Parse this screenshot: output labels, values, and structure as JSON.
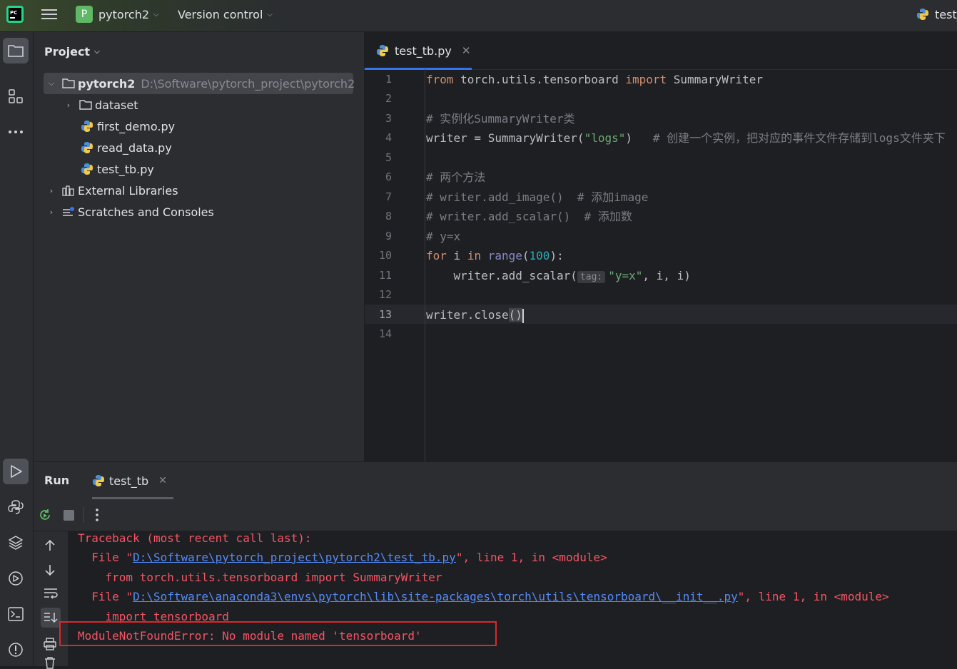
{
  "titlebar": {
    "project_badge": "P",
    "project_name": "pytorch2",
    "version_control": "Version control",
    "run_config": "test_"
  },
  "project_panel": {
    "title": "Project",
    "root_name": "pytorch2",
    "root_path": "D:\\Software\\pytorch_project\\pytorch2",
    "items": [
      {
        "label": "dataset",
        "kind": "folder"
      },
      {
        "label": "first_demo.py",
        "kind": "python"
      },
      {
        "label": "read_data.py",
        "kind": "python"
      },
      {
        "label": "test_tb.py",
        "kind": "python"
      }
    ],
    "external_libraries": "External Libraries",
    "scratches": "Scratches and Consoles"
  },
  "editor": {
    "tab_label": "test_tb.py",
    "line_numbers": [
      "1",
      "2",
      "3",
      "4",
      "5",
      "6",
      "7",
      "8",
      "9",
      "10",
      "11",
      "12",
      "13",
      "14"
    ],
    "current_line": "13",
    "code": {
      "l1_from": "from",
      "l1_mod": " torch.utils.tensorboard ",
      "l1_import": "import",
      "l1_name": " SummaryWriter",
      "l3": "# 实例化SummaryWriter类",
      "l4_code": "writer = SummaryWriter(",
      "l4_str": "\"logs\"",
      "l4_close": ")",
      "l4_comment": "   # 创建一个实例，把对应的事件文件存储到logs文件夹下",
      "l6": "# 两个方法",
      "l7": "# writer.add_image()  # 添加image",
      "l8": "# writer.add_scalar()  # 添加数",
      "l9": "# y=x",
      "l10_for": "for",
      "l10_i": " i ",
      "l10_in": "in",
      "l10_range": "range",
      "l10_open": "(",
      "l10_num": "100",
      "l10_close": "):",
      "l11_code": "    writer.add_scalar(",
      "l11_hint": "tag:",
      "l11_str": "\"y=x\"",
      "l11_rest": ", i, i)",
      "l13_code": "writer.close",
      "l13_paren": "()"
    }
  },
  "run_panel": {
    "title": "Run",
    "tab_label": "test_tb",
    "console": {
      "traceback": "Traceback (most recent call last):",
      "file1_prefix": "  File \"",
      "file1_path": "D:\\Software\\pytorch_project\\pytorch2\\test_tb.py",
      "file1_suffix": "\", line 1, in <module>",
      "code1": "    from torch.utils.tensorboard import SummaryWriter",
      "file2_prefix": "  File \"",
      "file2_path": "D:\\Software\\anaconda3\\envs\\pytorch\\lib\\site-packages\\torch\\utils\\tensorboard\\__init__.py",
      "file2_suffix": "\", line 1, in <module>",
      "code2": "    import tensorboard",
      "error": "ModuleNotFoundError: No module named 'tensorboard'"
    }
  },
  "colors": {
    "accent": "#3574f0",
    "error_text": "#f75464",
    "highlight_box": "#e0262b"
  }
}
